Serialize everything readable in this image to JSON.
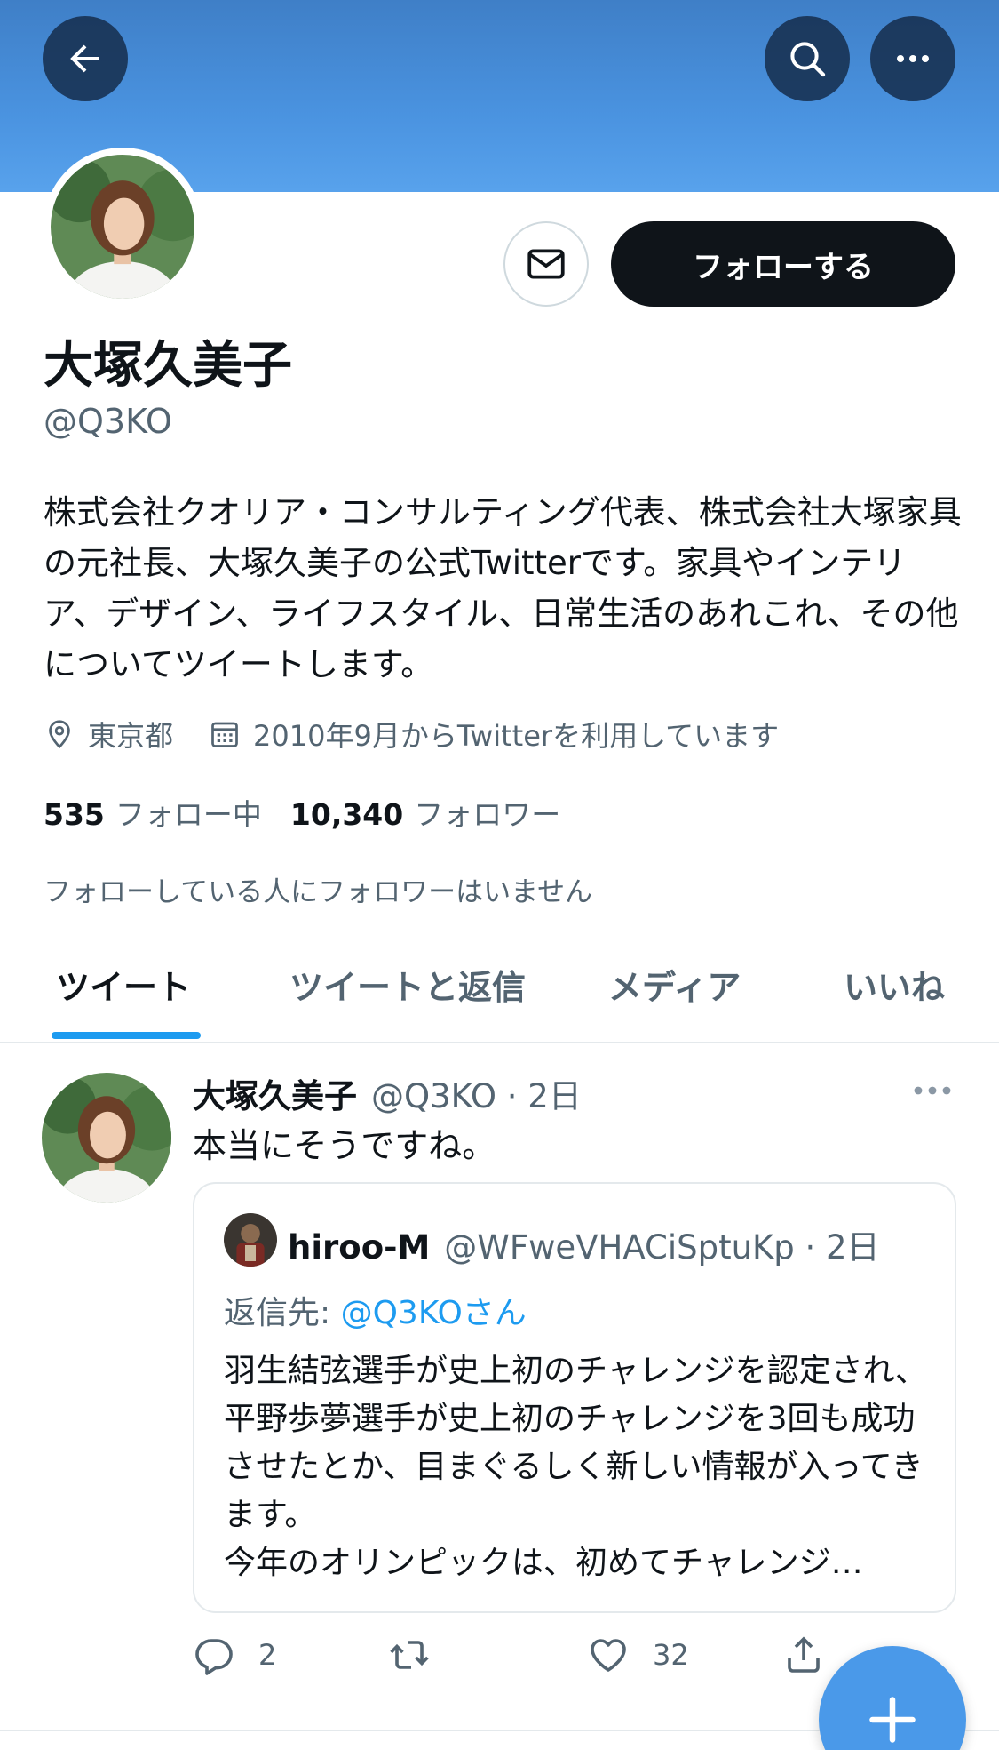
{
  "colors": {
    "banner": "#4a93e0",
    "accent": "#1d9bf0",
    "primary_text": "#0f1419",
    "secondary_text": "#536471",
    "follow_button": "#0f1419"
  },
  "header": {
    "back_icon": "arrow-left-icon",
    "search_icon": "search-icon",
    "more_icon": "more-horizontal-icon"
  },
  "profile": {
    "display_name": "大塚久美子",
    "handle": "@Q3KO",
    "follow_label": "フォローする",
    "message_icon": "mail-icon",
    "bio": "株式会社クオリア・コンサルティング代表、株式会社大塚家具の元社長、大塚久美子の公式Twitterです。家具やインテリア、デザイン、ライフスタイル、日常生活のあれこれ、その他についてツイートします。",
    "location": "東京都",
    "joined": "2010年9月からTwitterを利用しています",
    "following_count": "535",
    "following_label": "フォロー中",
    "followers_count": "10,340",
    "followers_label": "フォロワー",
    "followers_you_know": "フォローしている人にフォロワーはいません"
  },
  "tabs": [
    {
      "label": "ツイート",
      "active": true
    },
    {
      "label": "ツイートと返信",
      "active": false
    },
    {
      "label": "メディア",
      "active": false
    },
    {
      "label": "いいね",
      "active": false
    }
  ],
  "tweet": {
    "author_name": "大塚久美子",
    "author_handle_time": "@Q3KO · 2日",
    "text": "本当にそうですね。",
    "quote": {
      "author_name": "hiroo-M",
      "author_handle_time": "@WFweVHACiSptuKp · 2日",
      "reply_prefix": "返信先: ",
      "reply_mention": "@Q3KOさん",
      "text": "羽生結弦選手が史上初のチャレンジを認定され、平野歩夢選手が史上初のチャレンジを3回も成功させたとか、目まぐるしく新しい情報が入ってきます。\n今年のオリンピックは、初めてチャレンジ…"
    },
    "replies": "2",
    "retweets": "",
    "likes": "32"
  },
  "fab_icon": "plus-icon"
}
